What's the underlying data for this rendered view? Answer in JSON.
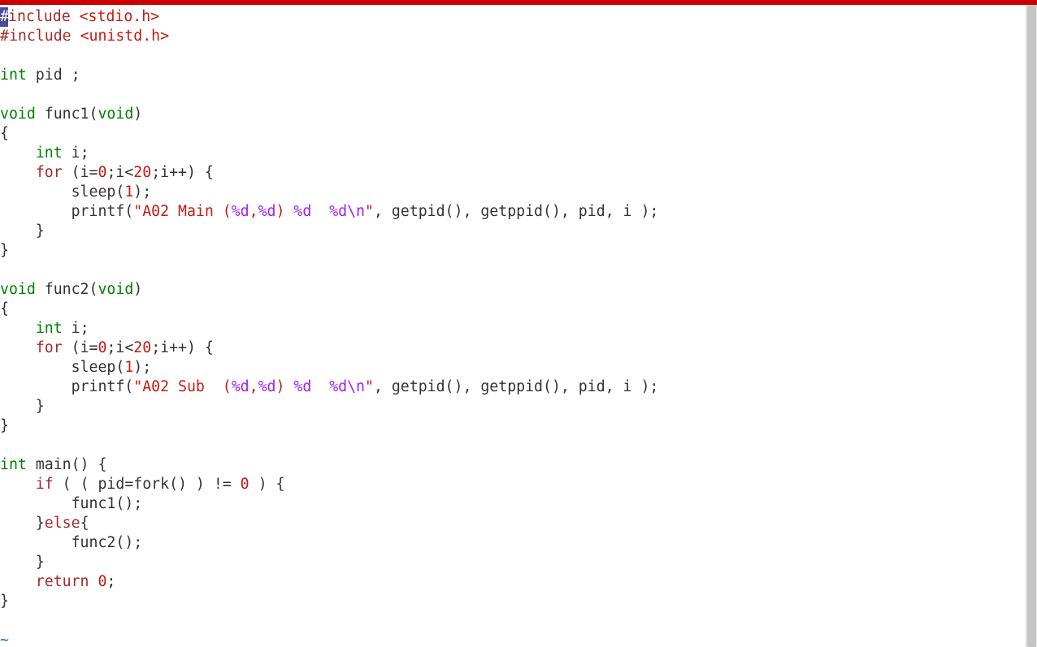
{
  "titlebar": {
    "color": "#cc0000"
  },
  "code": {
    "lines": [
      {
        "tokens": [
          {
            "cls": "cursor-block",
            "t": "#"
          },
          {
            "cls": "tok-preproc",
            "t": "include "
          },
          {
            "cls": "tok-header",
            "t": "<stdio.h>"
          }
        ]
      },
      {
        "tokens": [
          {
            "cls": "tok-preproc",
            "t": "#include "
          },
          {
            "cls": "tok-header",
            "t": "<unistd.h>"
          }
        ]
      },
      {
        "tokens": [
          {
            "cls": "tok-ident",
            "t": ""
          }
        ]
      },
      {
        "tokens": [
          {
            "cls": "tok-type",
            "t": "int"
          },
          {
            "cls": "tok-ident",
            "t": " pid ;"
          }
        ]
      },
      {
        "tokens": [
          {
            "cls": "tok-ident",
            "t": ""
          }
        ]
      },
      {
        "tokens": [
          {
            "cls": "tok-type",
            "t": "void"
          },
          {
            "cls": "tok-ident",
            "t": " func1("
          },
          {
            "cls": "tok-type",
            "t": "void"
          },
          {
            "cls": "tok-ident",
            "t": ")"
          }
        ]
      },
      {
        "tokens": [
          {
            "cls": "tok-ident",
            "t": "{"
          }
        ]
      },
      {
        "tokens": [
          {
            "cls": "tok-ident",
            "t": "    "
          },
          {
            "cls": "tok-type",
            "t": "int"
          },
          {
            "cls": "tok-ident",
            "t": " i;"
          }
        ]
      },
      {
        "tokens": [
          {
            "cls": "tok-ident",
            "t": "    "
          },
          {
            "cls": "tok-keyword",
            "t": "for"
          },
          {
            "cls": "tok-ident",
            "t": " (i="
          },
          {
            "cls": "tok-number",
            "t": "0"
          },
          {
            "cls": "tok-ident",
            "t": ";i<"
          },
          {
            "cls": "tok-number",
            "t": "20"
          },
          {
            "cls": "tok-ident",
            "t": ";i++) {"
          }
        ]
      },
      {
        "tokens": [
          {
            "cls": "tok-ident",
            "t": "        sleep("
          },
          {
            "cls": "tok-number",
            "t": "1"
          },
          {
            "cls": "tok-ident",
            "t": ");"
          }
        ]
      },
      {
        "tokens": [
          {
            "cls": "tok-ident",
            "t": "        printf("
          },
          {
            "cls": "tok-string",
            "t": "\"A02 Main ("
          },
          {
            "cls": "tok-esc",
            "t": "%d"
          },
          {
            "cls": "tok-string",
            "t": ","
          },
          {
            "cls": "tok-esc",
            "t": "%d"
          },
          {
            "cls": "tok-string",
            "t": ") "
          },
          {
            "cls": "tok-esc",
            "t": "%d"
          },
          {
            "cls": "tok-string",
            "t": "  "
          },
          {
            "cls": "tok-esc",
            "t": "%d"
          },
          {
            "cls": "tok-esc",
            "t": "\\n"
          },
          {
            "cls": "tok-string",
            "t": "\""
          },
          {
            "cls": "tok-ident",
            "t": ", getpid(), getppid(), pid, i );"
          }
        ]
      },
      {
        "tokens": [
          {
            "cls": "tok-ident",
            "t": "    }"
          }
        ]
      },
      {
        "tokens": [
          {
            "cls": "tok-ident",
            "t": "}"
          }
        ]
      },
      {
        "tokens": [
          {
            "cls": "tok-ident",
            "t": ""
          }
        ]
      },
      {
        "tokens": [
          {
            "cls": "tok-type",
            "t": "void"
          },
          {
            "cls": "tok-ident",
            "t": " func2("
          },
          {
            "cls": "tok-type",
            "t": "void"
          },
          {
            "cls": "tok-ident",
            "t": ")"
          }
        ]
      },
      {
        "tokens": [
          {
            "cls": "tok-ident",
            "t": "{"
          }
        ]
      },
      {
        "tokens": [
          {
            "cls": "tok-ident",
            "t": "    "
          },
          {
            "cls": "tok-type",
            "t": "int"
          },
          {
            "cls": "tok-ident",
            "t": " i;"
          }
        ]
      },
      {
        "tokens": [
          {
            "cls": "tok-ident",
            "t": "    "
          },
          {
            "cls": "tok-keyword",
            "t": "for"
          },
          {
            "cls": "tok-ident",
            "t": " (i="
          },
          {
            "cls": "tok-number",
            "t": "0"
          },
          {
            "cls": "tok-ident",
            "t": ";i<"
          },
          {
            "cls": "tok-number",
            "t": "20"
          },
          {
            "cls": "tok-ident",
            "t": ";i++) {"
          }
        ]
      },
      {
        "tokens": [
          {
            "cls": "tok-ident",
            "t": "        sleep("
          },
          {
            "cls": "tok-number",
            "t": "1"
          },
          {
            "cls": "tok-ident",
            "t": ");"
          }
        ]
      },
      {
        "tokens": [
          {
            "cls": "tok-ident",
            "t": "        printf("
          },
          {
            "cls": "tok-string",
            "t": "\"A02 Sub  ("
          },
          {
            "cls": "tok-esc",
            "t": "%d"
          },
          {
            "cls": "tok-string",
            "t": ","
          },
          {
            "cls": "tok-esc",
            "t": "%d"
          },
          {
            "cls": "tok-string",
            "t": ") "
          },
          {
            "cls": "tok-esc",
            "t": "%d"
          },
          {
            "cls": "tok-string",
            "t": "  "
          },
          {
            "cls": "tok-esc",
            "t": "%d"
          },
          {
            "cls": "tok-esc",
            "t": "\\n"
          },
          {
            "cls": "tok-string",
            "t": "\""
          },
          {
            "cls": "tok-ident",
            "t": ", getpid(), getppid(), pid, i );"
          }
        ]
      },
      {
        "tokens": [
          {
            "cls": "tok-ident",
            "t": "    }"
          }
        ]
      },
      {
        "tokens": [
          {
            "cls": "tok-ident",
            "t": "}"
          }
        ]
      },
      {
        "tokens": [
          {
            "cls": "tok-ident",
            "t": ""
          }
        ]
      },
      {
        "tokens": [
          {
            "cls": "tok-type",
            "t": "int"
          },
          {
            "cls": "tok-ident",
            "t": " main() {"
          }
        ]
      },
      {
        "tokens": [
          {
            "cls": "tok-ident",
            "t": "    "
          },
          {
            "cls": "tok-keyword",
            "t": "if"
          },
          {
            "cls": "tok-ident",
            "t": " ( ( pid=fork() ) != "
          },
          {
            "cls": "tok-number",
            "t": "0"
          },
          {
            "cls": "tok-ident",
            "t": " ) {"
          }
        ]
      },
      {
        "tokens": [
          {
            "cls": "tok-ident",
            "t": "        func1();"
          }
        ]
      },
      {
        "tokens": [
          {
            "cls": "tok-ident",
            "t": "    }"
          },
          {
            "cls": "tok-keyword",
            "t": "else"
          },
          {
            "cls": "tok-ident",
            "t": "{"
          }
        ]
      },
      {
        "tokens": [
          {
            "cls": "tok-ident",
            "t": "        func2();"
          }
        ]
      },
      {
        "tokens": [
          {
            "cls": "tok-ident",
            "t": "    }"
          }
        ]
      },
      {
        "tokens": [
          {
            "cls": "tok-ident",
            "t": "    "
          },
          {
            "cls": "tok-keyword",
            "t": "return"
          },
          {
            "cls": "tok-ident",
            "t": " "
          },
          {
            "cls": "tok-number",
            "t": "0"
          },
          {
            "cls": "tok-ident",
            "t": ";"
          }
        ]
      },
      {
        "tokens": [
          {
            "cls": "tok-ident",
            "t": "}"
          }
        ]
      },
      {
        "tokens": [
          {
            "cls": "tok-ident",
            "t": ""
          }
        ]
      },
      {
        "tokens": [
          {
            "cls": "tilde",
            "t": "~"
          }
        ]
      }
    ]
  }
}
